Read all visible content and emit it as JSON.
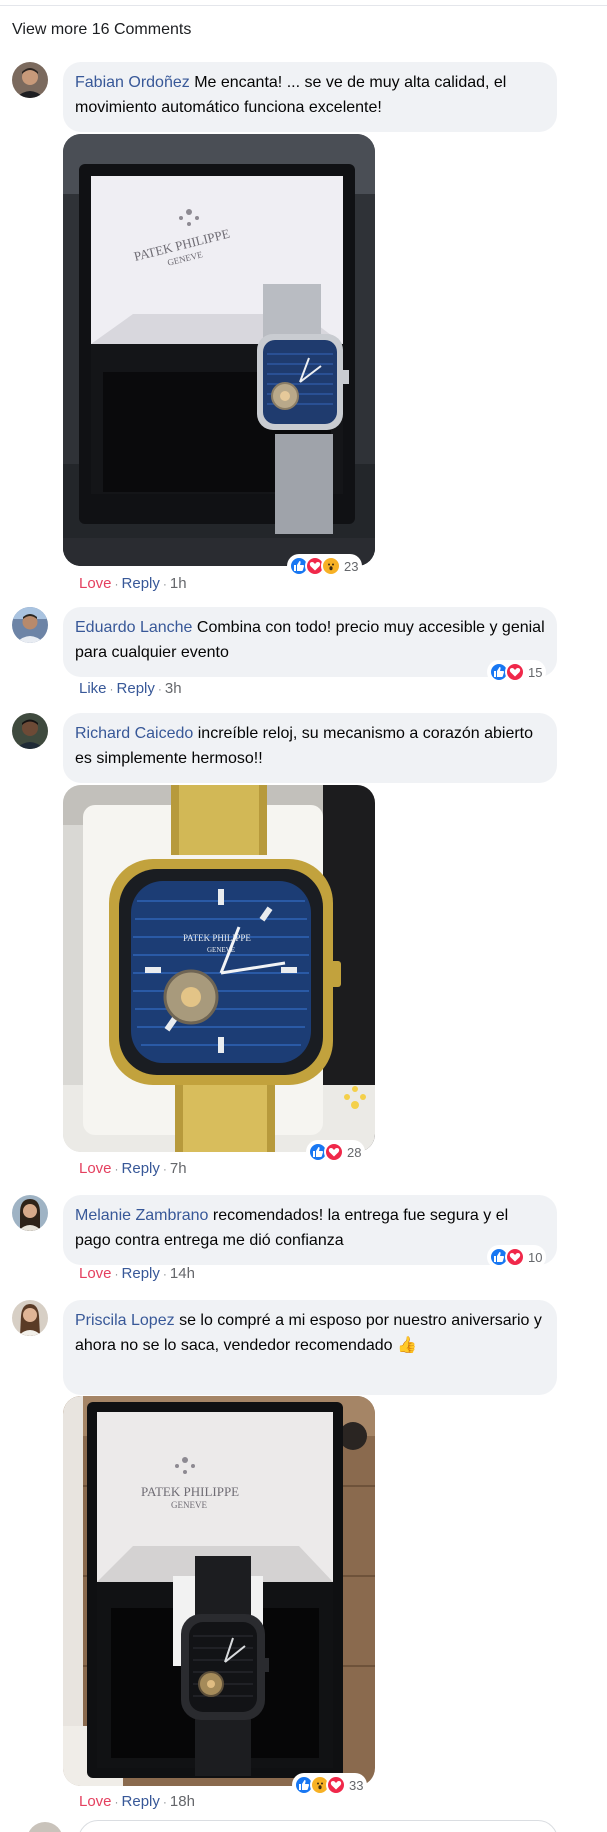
{
  "view_more_label": "View more 16 Comments",
  "comments": [
    {
      "author": "Fabian Ordoñez",
      "text": "Me encanta! ... se ve de muy alta calidad, el movimiento automático funciona excelente!",
      "action": "Love",
      "reply": "Reply",
      "time": "1h",
      "reaction_count": "23",
      "reactions": [
        "like",
        "love",
        "wow"
      ]
    },
    {
      "author": "Eduardo Lanche",
      "text": "Combina con todo! precio muy accesible y genial para cualquier evento",
      "action": "Like",
      "reply": "Reply",
      "time": "3h",
      "reaction_count": "15",
      "reactions": [
        "like",
        "love"
      ]
    },
    {
      "author": "Richard Caicedo",
      "text": "increíble reloj, su mecanismo a corazón abierto es simplemente hermoso!!",
      "action": "Love",
      "reply": "Reply",
      "time": "7h",
      "reaction_count": "28",
      "reactions": [
        "like",
        "love"
      ]
    },
    {
      "author": "Melanie Zambrano",
      "text": "recomendados! la entrega fue segura y el pago contra entrega me dió confianza",
      "action": "Love",
      "reply": "Reply",
      "time": "14h",
      "reaction_count": "10",
      "reactions": [
        "like",
        "love"
      ]
    },
    {
      "author": "Priscila Lopez",
      "text": "se lo compré a mi esposo por nuestro aniversario y ahora no se lo saca, vendedor recomendado",
      "emoji": "👍",
      "action": "Love",
      "reply": "Reply",
      "time": "18h",
      "reaction_count": "33",
      "reactions": [
        "like",
        "wow",
        "love"
      ]
    }
  ],
  "photos": {
    "box_brand": "PATEK PHILIPPE",
    "box_city": "GENEVE",
    "dial_brand": "PATEK PHILIPPE",
    "dial_city": "GENEVE"
  },
  "colors": {
    "author": "#385898",
    "love_action": "#e4405f",
    "bubble": "#f0f2f5",
    "like": "#1877f2",
    "love": "#f0284a",
    "wow": "#f7b125"
  }
}
